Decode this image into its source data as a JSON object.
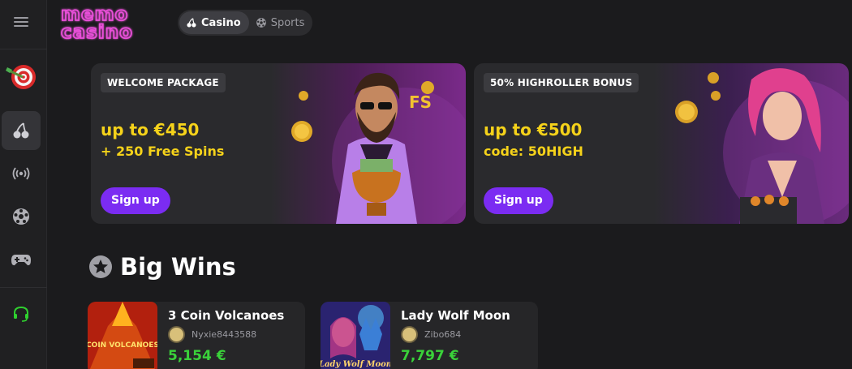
{
  "header": {
    "logo_line1": "memo",
    "logo_line2": "casino",
    "tabs": [
      {
        "label": "Casino",
        "icon": "cherries-icon",
        "active": true
      },
      {
        "label": "Sports",
        "icon": "soccer-ball-icon",
        "active": false
      }
    ]
  },
  "sidebar": {
    "items": [
      {
        "icon": "menu-icon"
      },
      {
        "icon": "dartboard-icon"
      },
      {
        "icon": "cherries-icon",
        "active": true
      },
      {
        "icon": "live-broadcast-icon"
      },
      {
        "icon": "soccer-ball-icon"
      },
      {
        "icon": "gamepad-icon"
      },
      {
        "icon": "support-headset-icon"
      }
    ]
  },
  "banners": [
    {
      "badge": "WELCOME PACKAGE",
      "line1": "up to €450",
      "line2": "+ 250 Free Spins",
      "cta": "Sign up"
    },
    {
      "badge": "50% HIGHROLLER BONUS",
      "line1": "up to €500",
      "line2": "code: 50HIGH",
      "cta": "Sign up"
    }
  ],
  "big_wins": {
    "title": "Big Wins",
    "items": [
      {
        "game": "3 Coin Volcanoes",
        "user": "Nyxie8443588",
        "amount": "5,154 €",
        "thumb_text": "COIN VOLCANOES"
      },
      {
        "game": "Lady Wolf Moon",
        "user": "Zibo684",
        "amount": "7,797 €",
        "thumb_text": "Lady Wolf Moon"
      }
    ]
  },
  "colors": {
    "accent": "#7b2cf2",
    "promo_yellow": "#f5d21a",
    "win_green": "#3ad23a",
    "logo_pink": "#e040d0"
  }
}
